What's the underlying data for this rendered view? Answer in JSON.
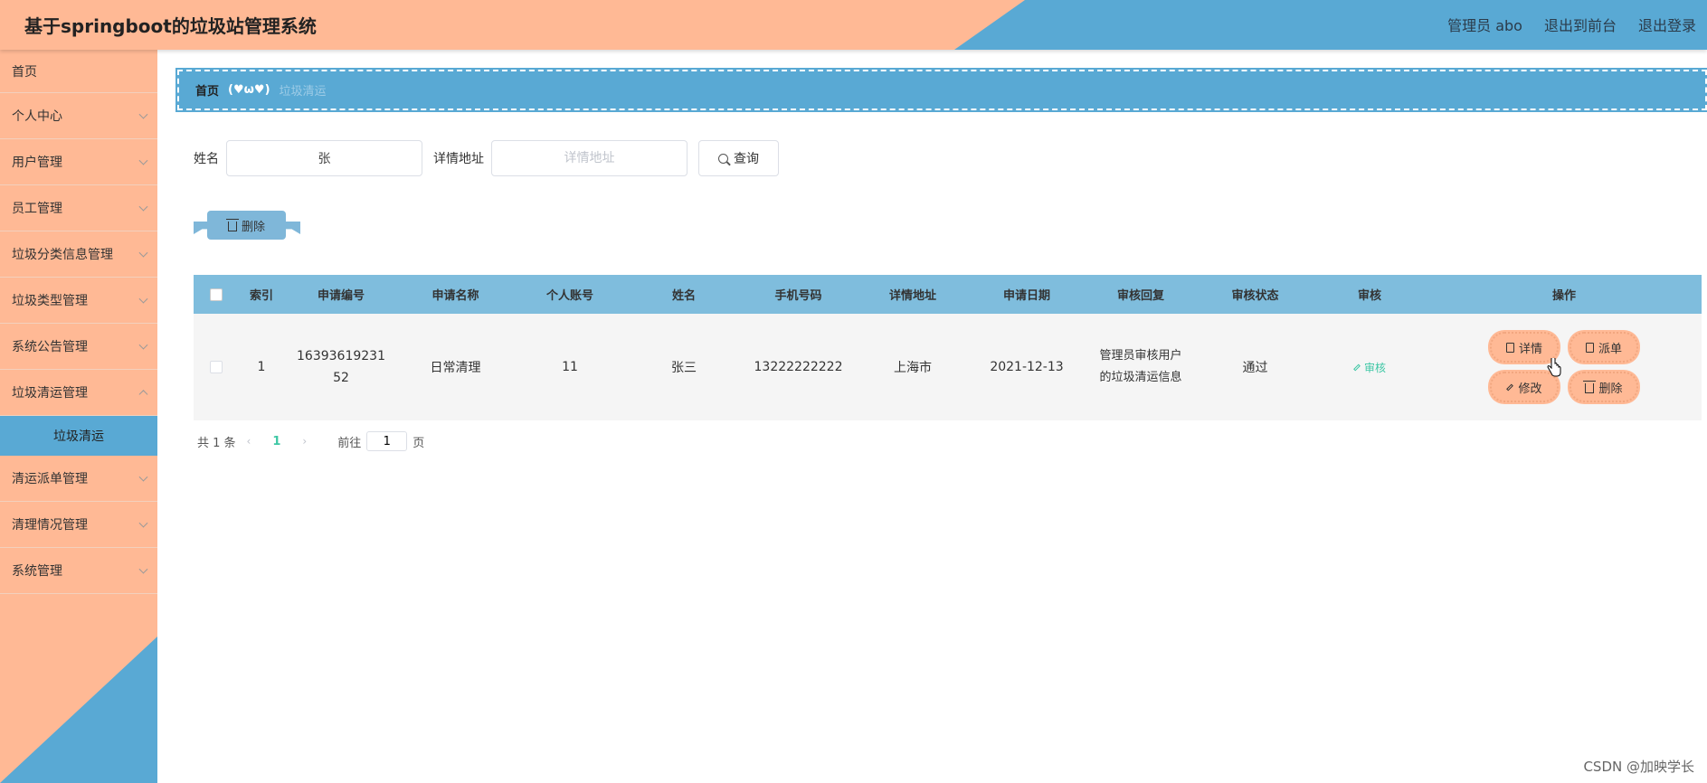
{
  "header": {
    "title": "基于springboot的垃圾站管理系统",
    "user": "管理员 abo",
    "front_link": "退出到前台",
    "logout_link": "退出登录",
    "colors": {
      "peach": "#ffb995",
      "blue": "#59a9d4"
    }
  },
  "sidebar": {
    "items": [
      {
        "label": "首页"
      },
      {
        "label": "个人中心"
      },
      {
        "label": "用户管理"
      },
      {
        "label": "员工管理"
      },
      {
        "label": "垃圾分类信息管理"
      },
      {
        "label": "垃圾类型管理"
      },
      {
        "label": "系统公告管理"
      },
      {
        "label": "垃圾清运管理"
      },
      {
        "label": "清运派单管理"
      },
      {
        "label": "清理情况管理"
      },
      {
        "label": "系统管理"
      }
    ],
    "active_sub": "垃圾清运"
  },
  "breadcrumb": {
    "home": "首页",
    "separator": "(♥ω♥)",
    "current": "垃圾清运"
  },
  "search": {
    "name_label": "姓名",
    "name_value": "张",
    "address_label": "详情地址",
    "address_placeholder": "详情地址",
    "query_button": "查询"
  },
  "batch_delete_label": "删除",
  "table": {
    "headers": [
      "索引",
      "申请编号",
      "申请名称",
      "个人账号",
      "姓名",
      "手机号码",
      "详情地址",
      "申请日期",
      "审核回复",
      "审核状态",
      "审核",
      "操作"
    ],
    "rows": [
      {
        "index": "1",
        "apply_no": "1639361923152",
        "apply_name": "日常清理",
        "account": "11",
        "name": "张三",
        "phone": "13222222222",
        "address": "上海市",
        "date": "2021-12-13",
        "reply": "管理员审核用户的垃圾清运信息",
        "status": "通过",
        "audit_link": "审核",
        "ops": {
          "detail": "详情",
          "dispatch": "派单",
          "edit": "修改",
          "delete": "删除"
        }
      }
    ]
  },
  "pagination": {
    "total": "共 1 条",
    "current_page": "1",
    "goto_label": "前往",
    "goto_value": "1",
    "page_suffix": "页"
  },
  "watermark": "CSDN @加映学长"
}
